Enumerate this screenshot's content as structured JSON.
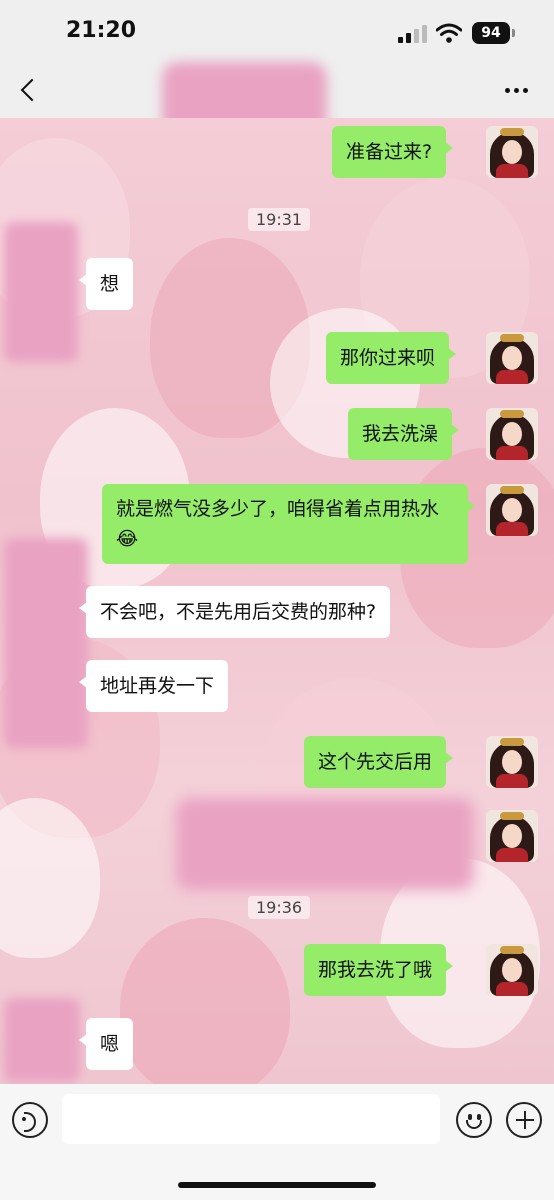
{
  "status": {
    "time": "21:20",
    "battery": "94"
  },
  "chat": {
    "timestamps": [
      "19:31",
      "19:36"
    ],
    "messages": [
      {
        "from": "me",
        "text": "准备过来?"
      },
      {
        "from": "other",
        "text": "想"
      },
      {
        "from": "me",
        "text": "那你过来呗"
      },
      {
        "from": "me",
        "text": "我去洗澡"
      },
      {
        "from": "me",
        "text": "就是燃气没多少了，咱得省着点用热水😂"
      },
      {
        "from": "other",
        "text": "不会吧，不是先用后交费的那种?"
      },
      {
        "from": "other",
        "text": "地址再发一下"
      },
      {
        "from": "me",
        "text": "这个先交后用"
      },
      {
        "from": "me",
        "text": "那我去洗了哦"
      },
      {
        "from": "other",
        "text": "嗯"
      }
    ]
  },
  "icons": {
    "back": "back-chevron-icon",
    "more": "more-dots-icon",
    "voice": "voice-icon",
    "emoji": "emoji-icon",
    "plus": "plus-icon"
  },
  "colors": {
    "my_bubble": "#95ec69",
    "other_bubble": "#ffffff",
    "background": "#f3d7de"
  }
}
